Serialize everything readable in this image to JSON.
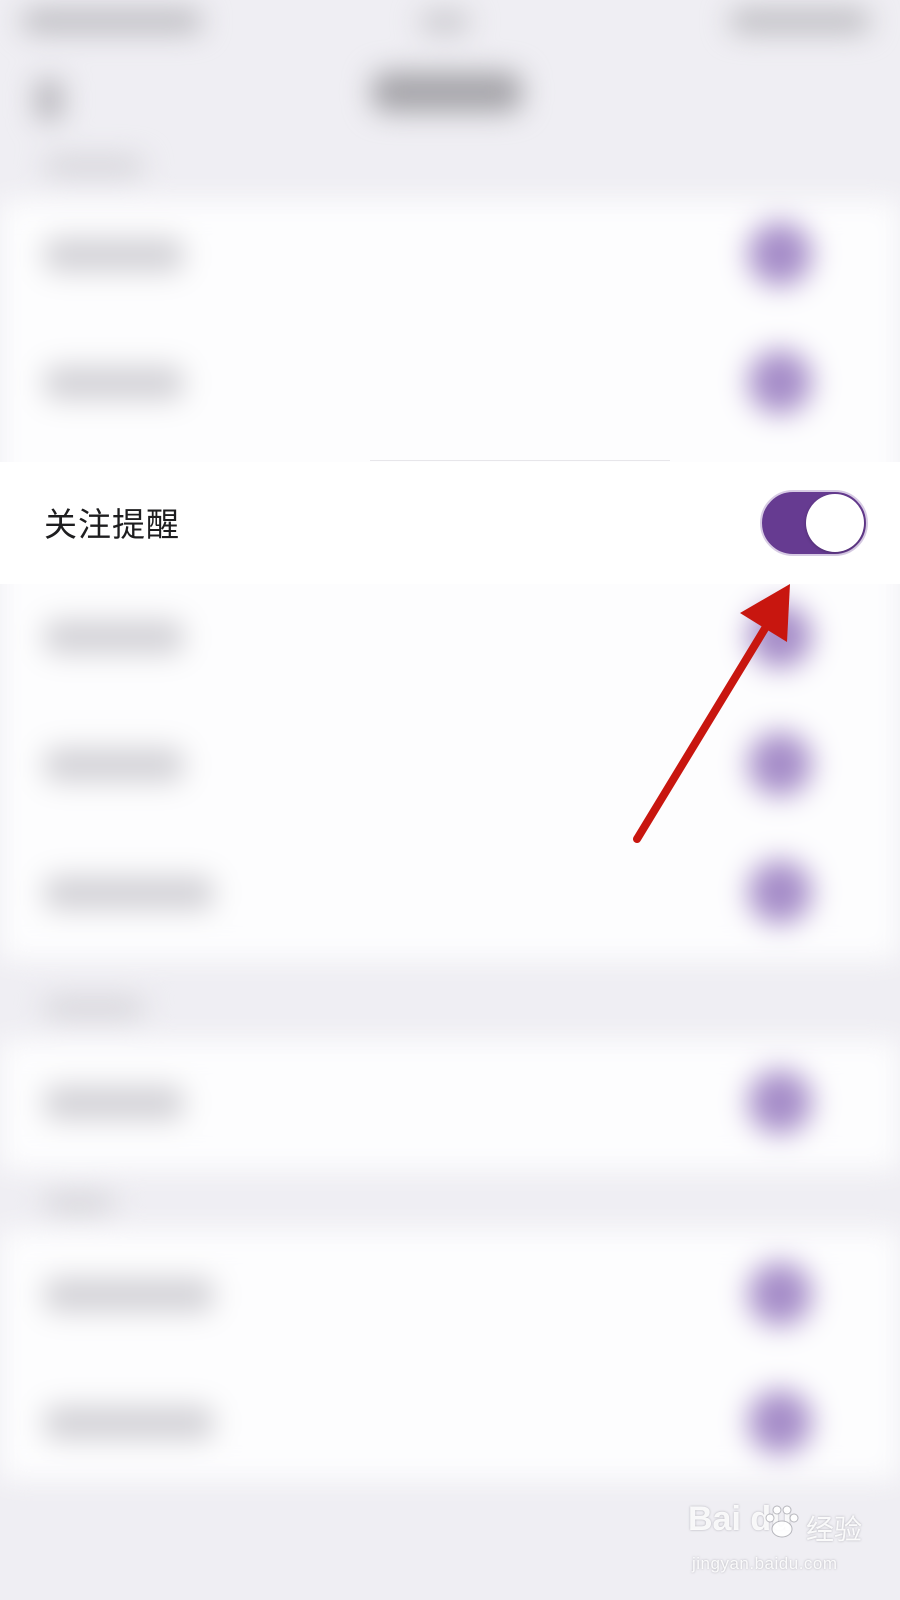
{
  "settings": {
    "highlighted_row": {
      "label": "关注提醒",
      "toggle_on": true,
      "toggle_color": "#663b91"
    },
    "blurred_toggle_color": "#a58cc8"
  },
  "annotation": {
    "arrow_color": "#c8160f"
  },
  "watermark": {
    "brand": "Bai du",
    "brand_cn": "经验",
    "url": "jingyan.baidu.com"
  }
}
